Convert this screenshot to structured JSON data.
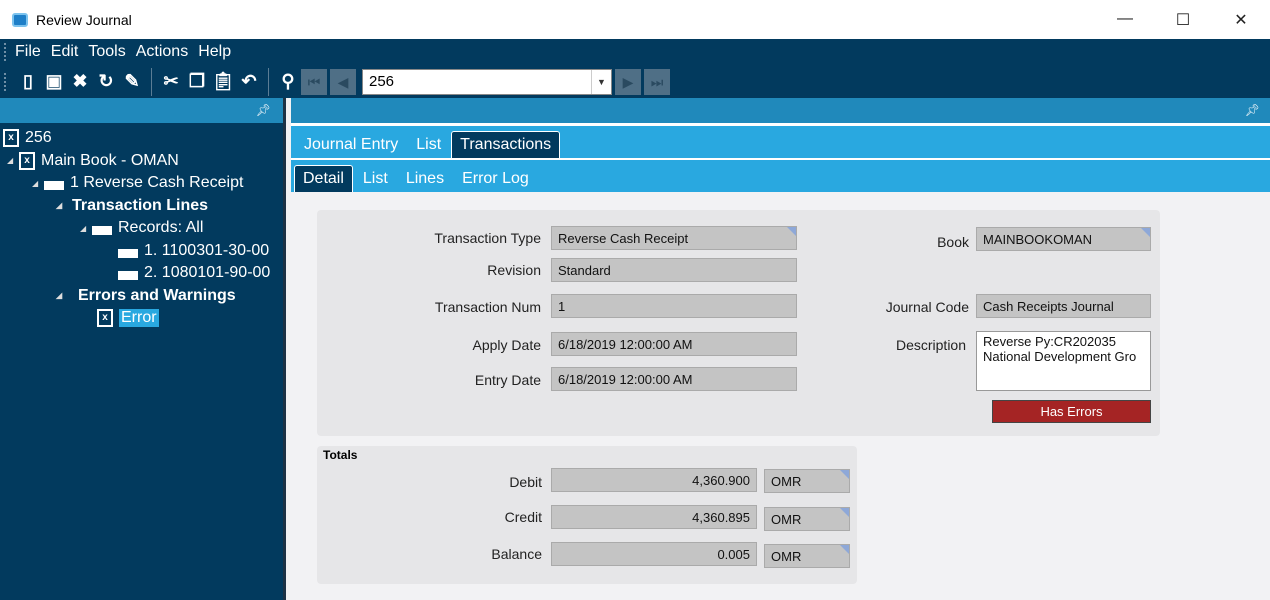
{
  "window": {
    "title": "Review Journal",
    "minimize": "—",
    "maximize": "☐",
    "close": "✕"
  },
  "menu": [
    "File",
    "Edit",
    "Tools",
    "Actions",
    "Help"
  ],
  "toolbar": {
    "record": "256"
  },
  "tree": {
    "root": "256",
    "book": "Main Book - OMAN",
    "txn": "1 Reverse Cash Receipt",
    "lines": "Transaction Lines",
    "records": "Records: All",
    "rec1": "1. 1100301-30-00",
    "rec2": "2. 1080101-90-00",
    "errors": "Errors and Warnings",
    "error": "Error"
  },
  "tabs": [
    "Journal Entry",
    "List",
    "Transactions"
  ],
  "subtabs": [
    "Detail",
    "List",
    "Lines",
    "Error Log"
  ],
  "detail": {
    "transaction_type_label": "Transaction Type",
    "transaction_type": "Reverse Cash Receipt",
    "revision_label": "Revision",
    "revision": "Standard",
    "transaction_num_label": "Transaction Num",
    "transaction_num": "1",
    "apply_date_label": "Apply Date",
    "apply_date": "6/18/2019 12:00:00 AM",
    "entry_date_label": "Entry Date",
    "entry_date": "6/18/2019 12:00:00 AM",
    "book_label": "Book",
    "book": "MAINBOOKOMAN",
    "journal_code_label": "Journal Code",
    "journal_code": "Cash Receipts Journal",
    "description_label": "Description",
    "description": "Reverse Py:CR202035 National Development Gro",
    "has_errors": "Has Errors"
  },
  "totals": {
    "title": "Totals",
    "debit_label": "Debit",
    "debit": "4,360.900",
    "credit_label": "Credit",
    "credit": "4,360.895",
    "balance_label": "Balance",
    "balance": "0.005",
    "currency": "OMR"
  }
}
